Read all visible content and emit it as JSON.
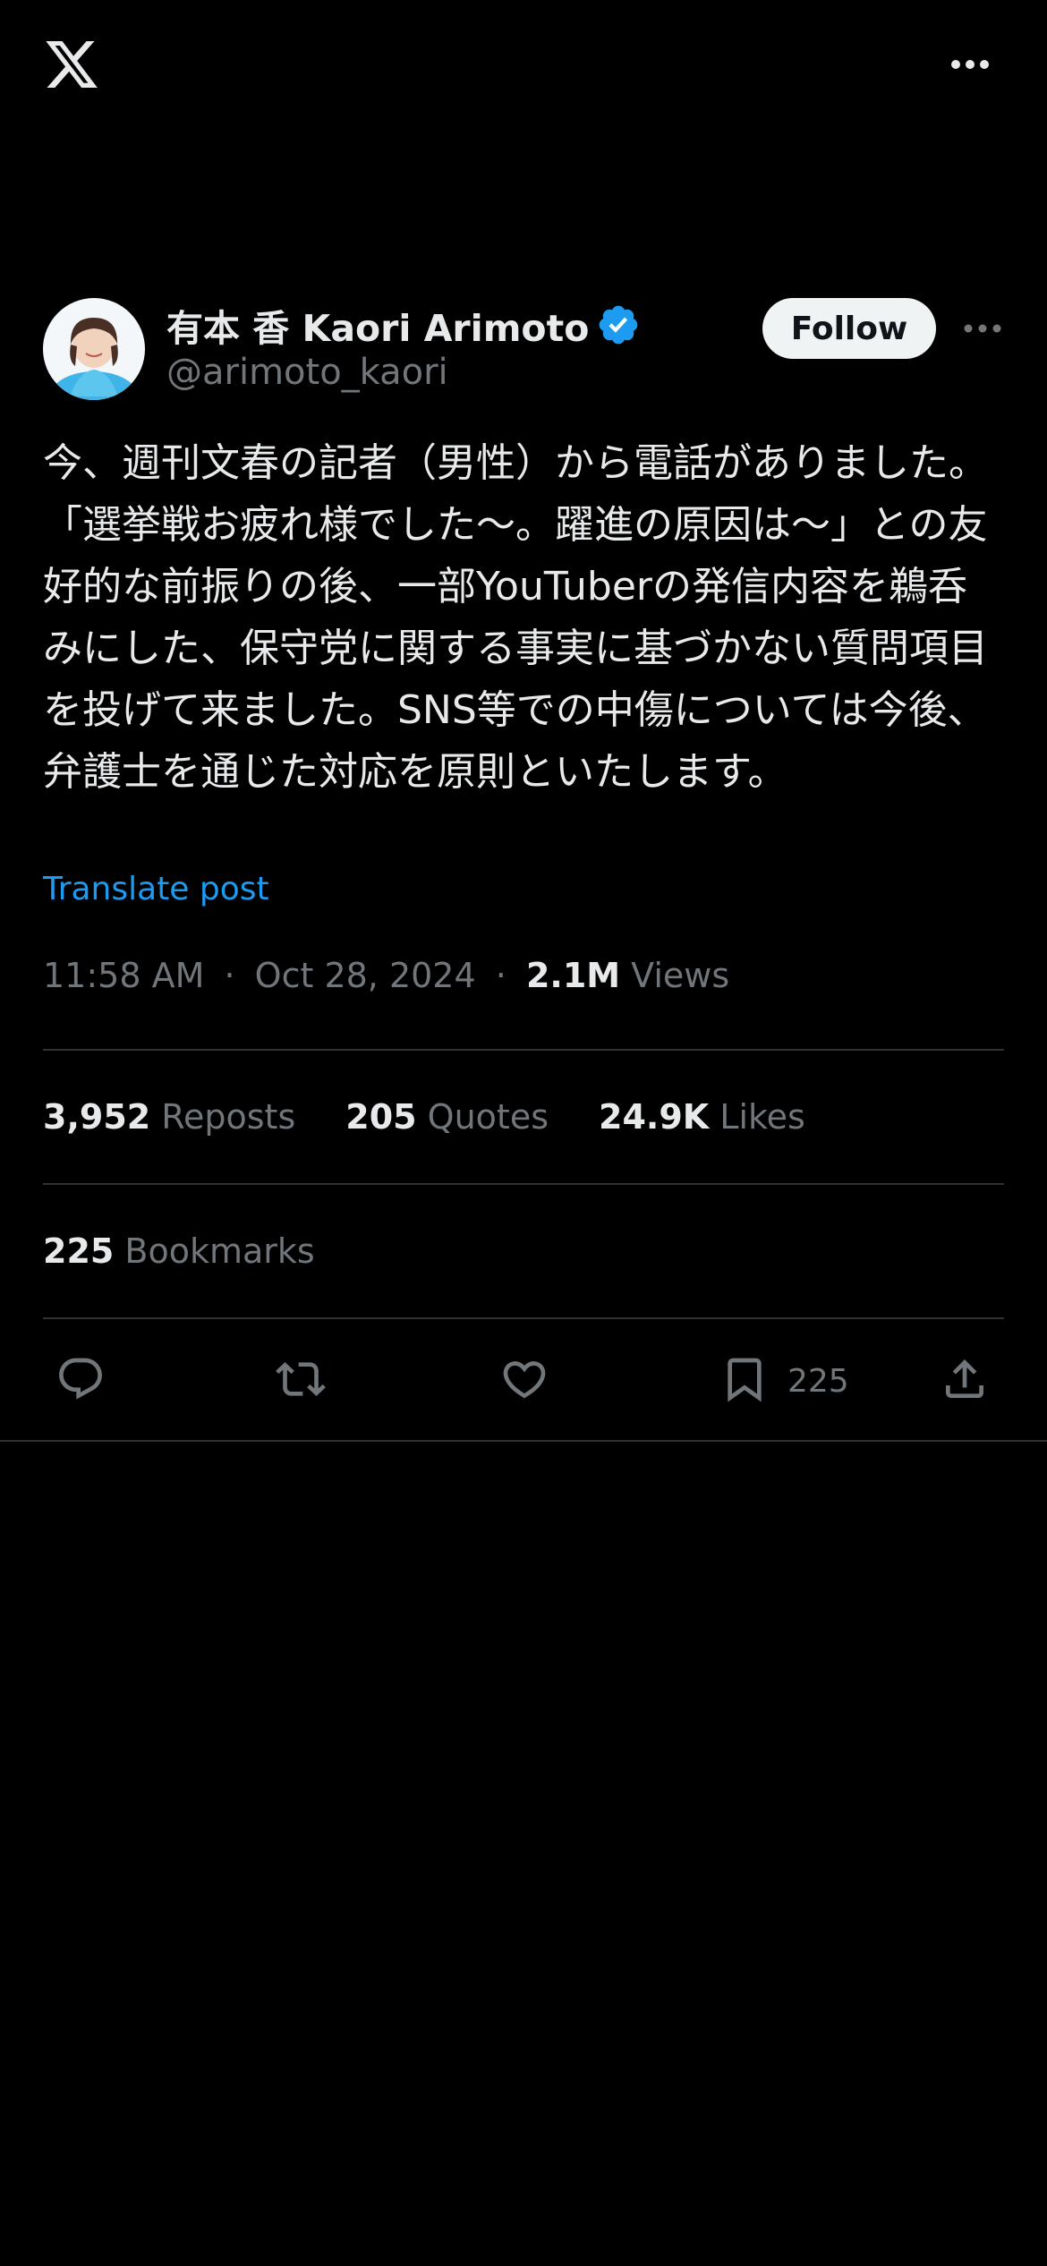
{
  "icons": {
    "logo": "x-logo-icon",
    "top_more": "more-horizontal-icon",
    "verified": "verified-badge-icon",
    "post_more": "more-horizontal-icon",
    "reply": "reply-icon",
    "repost": "repost-icon",
    "like": "heart-icon",
    "bookmark": "bookmark-icon",
    "share": "share-icon"
  },
  "colors": {
    "background": "#000000",
    "text": "#e7e9ea",
    "muted": "#71767b",
    "accent": "#1d9bf0",
    "divider": "#2f3336",
    "follow_bg": "#eff3f4"
  },
  "post": {
    "author": {
      "display_name": "有本 香 Kaori Arimoto",
      "handle": "@arimoto_kaori",
      "verified": true
    },
    "follow_label": "Follow",
    "text": "今、週刊文春の記者（男性）から電話がありました。「選挙戦お疲れ様でした〜。躍進の原因は〜」との友好的な前振りの後、一部YouTuberの発信内容を鵜呑みにした、保守党に関する事実に基づかない質問項目を投げて来ました。SNS等での中傷については今後、弁護士を通じた対応を原則といたします。",
    "translate_label": "Translate post",
    "time": "11:58 AM",
    "separator": "·",
    "date": "Oct 28, 2024",
    "views_count": "2.1M",
    "views_label": "Views"
  },
  "stats": {
    "reposts": {
      "count": "3,952",
      "label": "Reposts"
    },
    "quotes": {
      "count": "205",
      "label": "Quotes"
    },
    "likes": {
      "count": "24.9K",
      "label": "Likes"
    },
    "bookmarks": {
      "count": "225",
      "label": "Bookmarks"
    }
  },
  "actions": {
    "bookmark_count": "225"
  }
}
